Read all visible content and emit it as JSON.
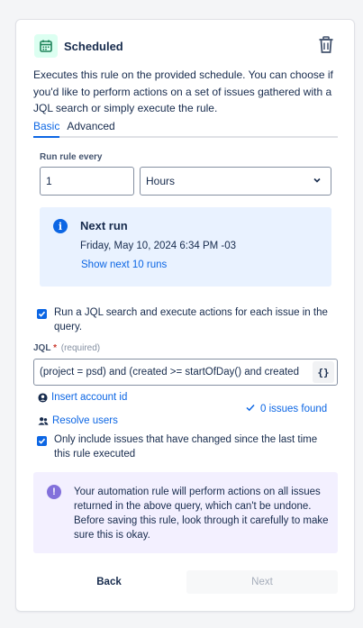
{
  "header": {
    "title": "Scheduled",
    "icon": "calendar-icon",
    "delete_icon": "trash-icon"
  },
  "description": "Executes this rule on the provided schedule. You can choose if you'd like to perform actions on a set of issues gathered with a JQL search or simply execute the rule.",
  "tabs": [
    {
      "label": "Basic",
      "active": true
    },
    {
      "label": "Advanced",
      "active": false
    }
  ],
  "schedule": {
    "run_label": "Run rule every",
    "interval_value": "1",
    "interval_unit": "Hours"
  },
  "next_run": {
    "title": "Next run",
    "date": "Friday, May 10, 2024 6:34 PM -03",
    "link": "Show next 10 runs"
  },
  "jql_search": {
    "checkbox_label": "Run a JQL search and execute actions for each issue in the query.",
    "checked": true,
    "label": "JQL",
    "required_mark": "*",
    "required_text": "(required)",
    "value": "(project = psd) and (created >= startOfDay() and created",
    "brace_button": "{}",
    "insert_account_link": "Insert account id",
    "resolve_users_link": "Resolve users",
    "issues_found": "0 issues found"
  },
  "changed_only": {
    "label": "Only include issues that have changed since the last time this rule executed",
    "checked": true
  },
  "warning": {
    "text": "Your automation rule will perform actions on all issues returned in the above query, which can't be undone. Before saving this rule, look through it carefully to make sure this is okay."
  },
  "footer": {
    "back_label": "Back",
    "next_label": "Next"
  },
  "colors": {
    "accent": "#0c66e4",
    "info_bg": "#e9f2ff",
    "warning_bg": "#f3f0ff",
    "warning_icon": "#8270db",
    "app_icon_bg": "#dcfff1"
  }
}
